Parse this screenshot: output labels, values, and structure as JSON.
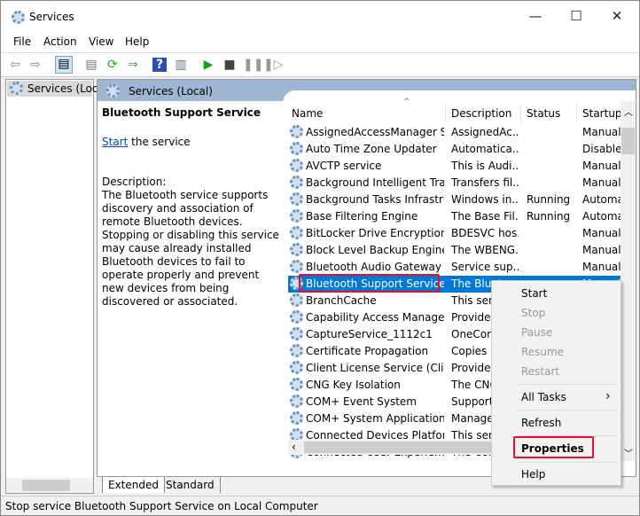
{
  "window": {
    "title": "Services",
    "minimize": "—",
    "maximize": "☐",
    "close": "✕"
  },
  "menubar": [
    "File",
    "Action",
    "View",
    "Help"
  ],
  "toolbar": {
    "icons": [
      "back-icon",
      "forward-icon",
      "show-hide-console-tree-icon",
      "properties-icon",
      "refresh-icon",
      "export-list-icon",
      "help-icon",
      "action-pane-icon",
      "start-service-icon",
      "stop-service-icon",
      "pause-service-icon",
      "restart-service-icon"
    ]
  },
  "tree": {
    "item": "Services (Local)"
  },
  "header": {
    "title": "Services (Local)"
  },
  "details": {
    "service_name": "Bluetooth Support Service",
    "start_link": "Start",
    "start_suffix": " the service",
    "description_label": "Description:",
    "description": "The Bluetooth service supports discovery and association of remote Bluetooth devices.  Stopping or disabling this service may cause already installed Bluetooth devices to fail to operate properly and prevent new devices from being discovered or associated."
  },
  "columns": [
    "Name",
    "Description",
    "Status",
    "Startup Type"
  ],
  "rows": [
    {
      "name": "AssignedAccessManager Se...",
      "desc": "AssignedAc...",
      "status": "",
      "startup": "Manual"
    },
    {
      "name": "Auto Time Zone Updater",
      "desc": "Automatica...",
      "status": "",
      "startup": "Disabled"
    },
    {
      "name": "AVCTP service",
      "desc": "This is Audi...",
      "status": "",
      "startup": "Manual"
    },
    {
      "name": "Background Intelligent Tran...",
      "desc": "Transfers fil...",
      "status": "",
      "startup": "Manual"
    },
    {
      "name": "Background Tasks Infrastru...",
      "desc": "Windows in...",
      "status": "Running",
      "startup": "Automatic"
    },
    {
      "name": "Base Filtering Engine",
      "desc": "The Base Fil...",
      "status": "Running",
      "startup": "Automatic"
    },
    {
      "name": "BitLocker Drive Encryption ...",
      "desc": "BDESVC hos...",
      "status": "",
      "startup": "Manual"
    },
    {
      "name": "Block Level Backup Engine ...",
      "desc": "The WBENG...",
      "status": "",
      "startup": "Manual"
    },
    {
      "name": "Bluetooth Audio Gateway S...",
      "desc": "Service sup...",
      "status": "",
      "startup": "Manual"
    },
    {
      "name": "Bluetooth Support Service",
      "desc": "The Blueto...",
      "status": "",
      "startup": "Manual"
    },
    {
      "name": "BranchCache",
      "desc": "This service...",
      "status": "",
      "startup": ""
    },
    {
      "name": "Capability Access Manager ...",
      "desc": "Provides fac...",
      "status": "",
      "startup": ""
    },
    {
      "name": "CaptureService_1112c1",
      "desc": "OneCore Ca...",
      "status": "",
      "startup": ""
    },
    {
      "name": "Certificate Propagation",
      "desc": "Copies user...",
      "status": "",
      "startup": ""
    },
    {
      "name": "Client License Service (ClipS...",
      "desc": "Provides inf...",
      "status": "",
      "startup": ""
    },
    {
      "name": "CNG Key Isolation",
      "desc": "The CNG ke...",
      "status": "",
      "startup": ""
    },
    {
      "name": "COM+ Event System",
      "desc": "Supports Sy...",
      "status": "",
      "startup": ""
    },
    {
      "name": "COM+ System Application",
      "desc": "Manages th...",
      "status": "",
      "startup": ""
    },
    {
      "name": "Connected Devices Platfor...",
      "desc": "This service...",
      "status": "",
      "startup": ""
    },
    {
      "name": "Connected User Experience...",
      "desc": "The Connec...",
      "status": "",
      "startup": ""
    }
  ],
  "tabs": [
    "Extended",
    "Standard"
  ],
  "status_text": "Stop service Bluetooth Support Service on Local Computer",
  "context_menu": [
    {
      "label": "Start",
      "enabled": true
    },
    {
      "label": "Stop",
      "enabled": false
    },
    {
      "label": "Pause",
      "enabled": false
    },
    {
      "label": "Resume",
      "enabled": false
    },
    {
      "label": "Restart",
      "enabled": false
    },
    {
      "label": "All Tasks",
      "enabled": true,
      "submenu": "›"
    },
    {
      "label": "Refresh",
      "enabled": true
    },
    {
      "label": "Properties",
      "enabled": true
    },
    {
      "label": "Help",
      "enabled": true
    }
  ],
  "colors": {
    "selection": "#0078d7",
    "highlight": "#e81123",
    "band": "#9fb6d2"
  }
}
